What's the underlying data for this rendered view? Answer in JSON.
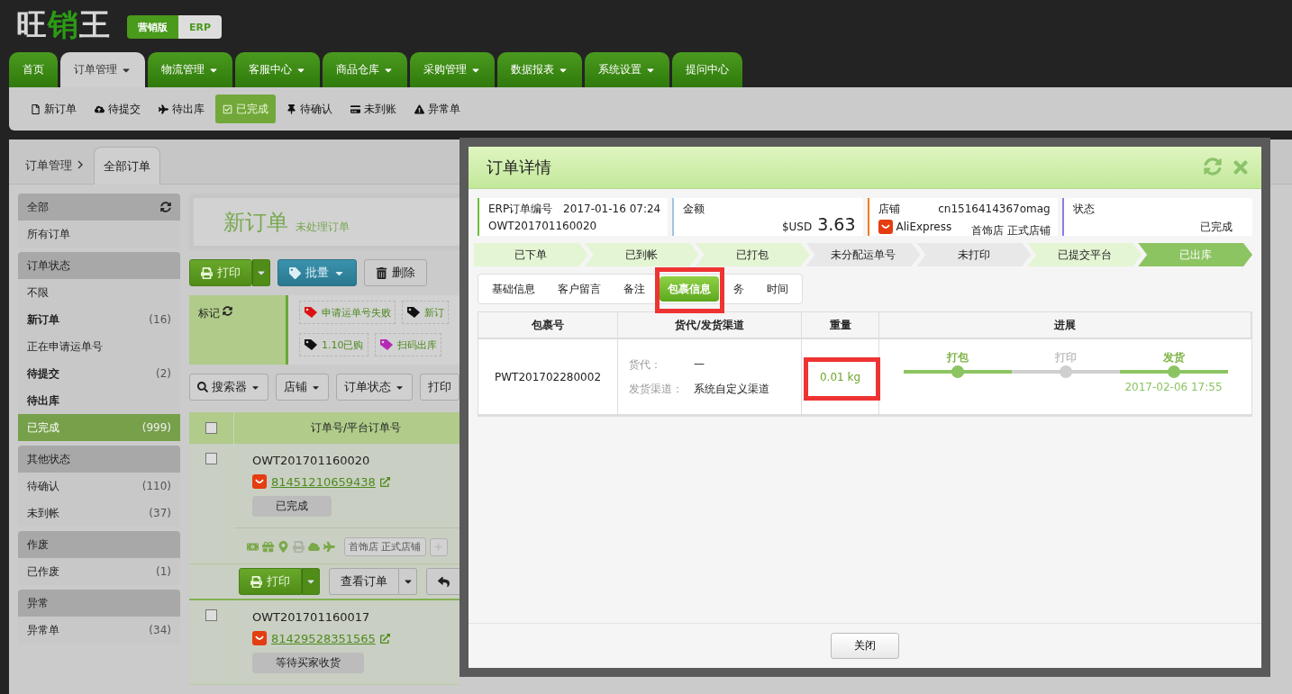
{
  "header": {
    "logo": [
      {
        "text": "旺",
        "accent": false
      },
      {
        "text": "销",
        "accent": true
      },
      {
        "text": "王",
        "accent": false
      }
    ],
    "editions": [
      {
        "label": "营销版",
        "selected": false
      },
      {
        "label": "ERP",
        "selected": true
      }
    ]
  },
  "nav": [
    {
      "label": "首页",
      "selected": false,
      "dropdown": false
    },
    {
      "label": "订单管理",
      "selected": true,
      "dropdown": true
    },
    {
      "label": "物流管理",
      "selected": false,
      "dropdown": true
    },
    {
      "label": "客服中心",
      "selected": false,
      "dropdown": true
    },
    {
      "label": "商品仓库",
      "selected": false,
      "dropdown": true
    },
    {
      "label": "采购管理",
      "selected": false,
      "dropdown": true
    },
    {
      "label": "数据报表",
      "selected": false,
      "dropdown": true
    },
    {
      "label": "系统设置",
      "selected": false,
      "dropdown": true
    },
    {
      "label": "提问中心",
      "selected": false,
      "dropdown": false
    }
  ],
  "subnav": [
    {
      "kind": "new",
      "label": "新订单",
      "selected": false
    },
    {
      "kind": "submit",
      "label": "待提交",
      "selected": false
    },
    {
      "kind": "ship",
      "label": "待出库",
      "selected": false
    },
    {
      "kind": "done",
      "label": "已完成",
      "selected": true
    },
    {
      "kind": "confirm",
      "label": "待确认",
      "selected": false
    },
    {
      "kind": "unpaid",
      "label": "未到账",
      "selected": false
    },
    {
      "kind": "error",
      "label": "异常单",
      "selected": false
    }
  ],
  "breadcrumb": {
    "root": "订单管理",
    "tab": "全部订单"
  },
  "sidebar": [
    {
      "title": "全部",
      "refresh": true,
      "items": [
        {
          "label": "所有订单",
          "bold": false,
          "selected": false
        }
      ]
    },
    {
      "title": "订单状态",
      "refresh": false,
      "items": [
        {
          "label": "不限",
          "bold": false,
          "selected": false
        },
        {
          "label": "新订单",
          "count": "(16)",
          "bold": true,
          "selected": false
        },
        {
          "label": "正在申请运单号",
          "bold": false,
          "selected": false
        },
        {
          "label": "待提交",
          "count": "(2)",
          "bold": true,
          "selected": false
        },
        {
          "label": "待出库",
          "bold": true,
          "selected": false
        },
        {
          "label": "已完成",
          "count": "(999)",
          "bold": false,
          "selected": true
        }
      ]
    },
    {
      "title": "其他状态",
      "refresh": false,
      "items": [
        {
          "label": "待确认",
          "count": "(110)",
          "bold": false,
          "selected": false
        },
        {
          "label": "未到帐",
          "count": "(37)",
          "bold": false,
          "selected": false
        }
      ]
    },
    {
      "title": "作废",
      "refresh": false,
      "items": [
        {
          "label": "已作废",
          "count": "(1)",
          "bold": false,
          "selected": false
        }
      ]
    },
    {
      "title": "异常",
      "refresh": false,
      "items": [
        {
          "label": "异常单",
          "count": "(34)",
          "bold": false,
          "selected": false
        }
      ]
    }
  ],
  "content": {
    "title": "新订单",
    "subtitle": "未处理订单",
    "actions": [
      {
        "kind": "print",
        "label": "打印"
      },
      {
        "kind": "batch",
        "label": "批量"
      },
      {
        "kind": "delete",
        "label": "删除"
      }
    ],
    "marks": {
      "label": "标记",
      "rows": [
        [
          {
            "label": "申请运单号失败",
            "color": "#dd1111"
          },
          {
            "label": "新订",
            "color": "#111111"
          }
        ],
        [
          {
            "label": "1.10已购",
            "color": "#111111"
          },
          {
            "label": "扫码出库",
            "color": "#b52ab5"
          }
        ]
      ]
    },
    "filters": [
      {
        "label": "搜索器",
        "search": true,
        "dropdown": true
      },
      {
        "label": "店铺",
        "search": false,
        "dropdown": true
      },
      {
        "label": "订单状态",
        "search": false,
        "dropdown": true
      },
      {
        "label": "打印",
        "search": false,
        "dropdown": false
      }
    ],
    "table": {
      "header": "订单号/平台订单号",
      "checked": false,
      "orders": [
        {
          "id": "OWT201701160020",
          "platform_id": "81451210659438",
          "status": "已完成",
          "checked": false,
          "flags": [
            {
              "kind": "money",
              "on": true
            },
            {
              "kind": "gift",
              "on": true
            },
            {
              "kind": "marker",
              "on": true
            },
            {
              "kind": "print",
              "on": false
            },
            {
              "kind": "cloud",
              "on": true
            },
            {
              "kind": "plane",
              "on": true
            }
          ],
          "store": "首饰店 正式店铺",
          "buttons": [
            {
              "kind": "print",
              "label": "打印",
              "dropdown": true
            },
            {
              "kind": "view",
              "label": "查看订单",
              "dropdown": true
            },
            {
              "kind": "undo",
              "dropdown": false
            }
          ]
        },
        {
          "id": "OWT201701160017",
          "platform_id": "81429528351565",
          "status": "等待买家收货",
          "checked": false
        }
      ]
    }
  },
  "modal": {
    "title": "订单详情",
    "cards": [
      {
        "color": "#6cbf3a",
        "label": "ERP订单编号",
        "extra": "2017-01-16 07:24",
        "value": "OWT201701160020",
        "kind": "order"
      },
      {
        "color": "#9fc4e6",
        "label": "金额",
        "currency": "$USD",
        "amount": "3.63",
        "kind": "amount"
      },
      {
        "color": "#f07d1e",
        "label": "店铺",
        "extra": "cn1516414367omag",
        "platform": "AliExpress",
        "value": "首饰店 正式店铺",
        "kind": "store"
      },
      {
        "color": "#8a7df0",
        "label": "状态",
        "value": "已完成",
        "kind": "status"
      }
    ],
    "steps": [
      {
        "label": "已下单",
        "kind": "done"
      },
      {
        "label": "已到帐",
        "kind": "done"
      },
      {
        "label": "已打包",
        "kind": "done"
      },
      {
        "label": "未分配运单号",
        "kind": "pending"
      },
      {
        "label": "未打印",
        "kind": "pending"
      },
      {
        "label": "已提交平台",
        "kind": "done"
      },
      {
        "label": "已出库",
        "kind": "current"
      }
    ],
    "tabs": [
      {
        "label": "基础信息",
        "selected": false,
        "highlighted": false
      },
      {
        "label": "客户留言",
        "selected": false,
        "highlighted": false
      },
      {
        "label": "备注",
        "selected": false,
        "highlighted": false
      },
      {
        "label": "包裹信息",
        "selected": true,
        "highlighted": true
      },
      {
        "label": "务",
        "selected": false,
        "highlighted": false
      },
      {
        "label": "时间",
        "selected": false,
        "highlighted": false
      }
    ],
    "packages": {
      "columns": [
        "包裹号",
        "货代/发货渠道",
        "重量",
        "进展"
      ],
      "rows": [
        {
          "id": "PWT201702280002",
          "forwarder_label": "货代：",
          "forwarder": "—",
          "channel_label": "发货渠道：",
          "channel": "系统自定义渠道",
          "weight": "0.01 kg",
          "weight_highlighted": true,
          "progress": [
            {
              "label": "打包",
              "done": true
            },
            {
              "label": "打印",
              "done": false
            },
            {
              "label": "发货",
              "done": true,
              "date": "2017-02-06 17:55"
            }
          ]
        }
      ]
    },
    "close": "关闭"
  }
}
